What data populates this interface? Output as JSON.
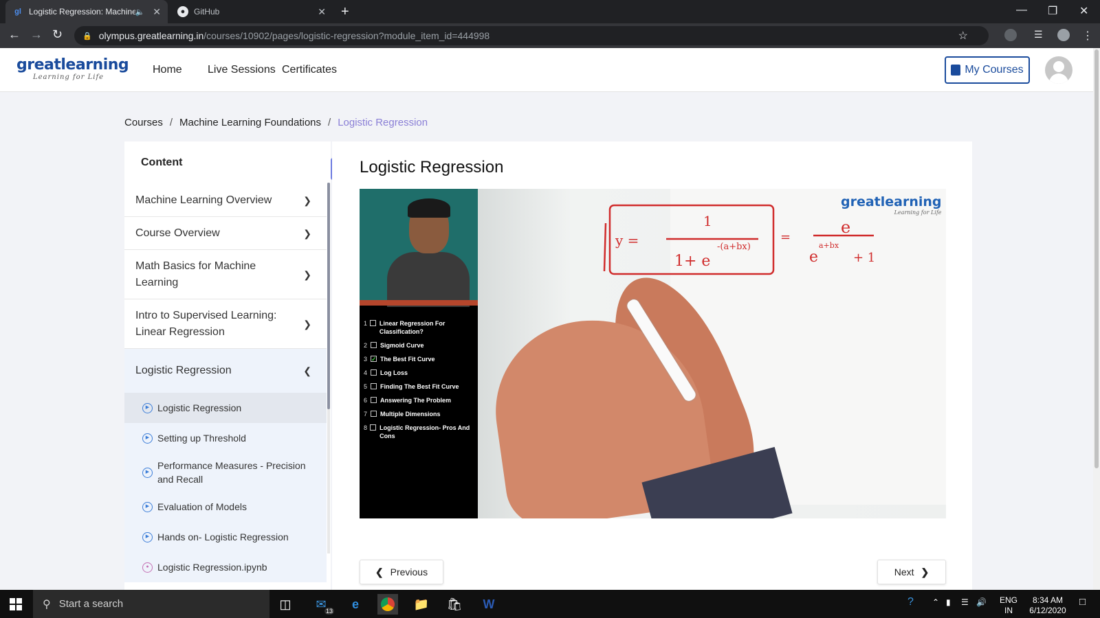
{
  "browser": {
    "tabs": [
      {
        "title": "Logistic Regression: Machine",
        "favicon": "greatlearning-favicon",
        "audio": true,
        "active": true
      },
      {
        "title": "GitHub",
        "favicon": "github-icon",
        "active": false
      }
    ],
    "new_tab_icon": "plus-icon",
    "url_host": "olympus.greatlearning.in",
    "url_path": "/courses/10902/pages/logistic-regression?module_item_id=444998"
  },
  "header": {
    "logo_brand": "greatlearning",
    "logo_tagline": "Learning for Life",
    "nav": [
      "Home",
      "Live Sessions",
      "Certificates"
    ],
    "my_courses_label": "My Courses"
  },
  "breadcrumb": {
    "items": [
      "Courses",
      "Machine Learning Foundations"
    ],
    "current": "Logistic Regression",
    "separator": "/"
  },
  "sidebar": {
    "title": "Content",
    "modules": [
      {
        "label": "Machine Learning Overview",
        "expanded": false
      },
      {
        "label": "Course Overview",
        "expanded": false
      },
      {
        "label": "Math Basics for Machine Learning",
        "expanded": false
      },
      {
        "label": "Intro to Supervised Learning: Linear Regression",
        "expanded": false
      },
      {
        "label": "Logistic Regression",
        "expanded": true
      }
    ],
    "items": [
      {
        "label": "Logistic Regression",
        "icon": "play-circle-icon",
        "active": true
      },
      {
        "label": "Setting up Threshold",
        "icon": "play-circle-icon"
      },
      {
        "label": "Performance Measures - Precision and Recall",
        "icon": "play-circle-icon"
      },
      {
        "label": "Evaluation of Models",
        "icon": "play-circle-icon"
      },
      {
        "label": "Hands on- Logistic Regression",
        "icon": "play-circle-icon"
      },
      {
        "label": "Logistic Regression.ipynb",
        "icon": "notebook-icon"
      }
    ]
  },
  "main": {
    "title": "Logistic Regression",
    "video": {
      "watermark_brand": "greatlearning",
      "watermark_tagline": "Learning for Life",
      "toc": [
        {
          "n": "1",
          "label": "Linear Regression For Classification?",
          "checked": false
        },
        {
          "n": "2",
          "label": "Sigmoid Curve",
          "checked": false
        },
        {
          "n": "3",
          "label": "The Best Fit Curve",
          "checked": true
        },
        {
          "n": "4",
          "label": "Log Loss",
          "checked": false
        },
        {
          "n": "5",
          "label": "Finding The Best Fit Curve",
          "checked": false
        },
        {
          "n": "6",
          "label": "Answering The Problem",
          "checked": false
        },
        {
          "n": "7",
          "label": "Multiple Dimensions",
          "checked": false
        },
        {
          "n": "8",
          "label": "Logistic Regression- Pros And Cons",
          "checked": false
        }
      ]
    },
    "previous_label": "Previous",
    "next_label": "Next"
  },
  "taskbar": {
    "search_placeholder": "Start a search",
    "mail_badge": "13",
    "lang": "ENG",
    "region": "IN",
    "time": "8:34 AM",
    "date": "6/12/2020"
  },
  "colors": {
    "brand_blue": "#1a4b9c",
    "breadcrumb_current": "#8a7fd6",
    "collapse_button": "#6c7ae0",
    "sidebar_active_bg": "#eef3fb"
  }
}
